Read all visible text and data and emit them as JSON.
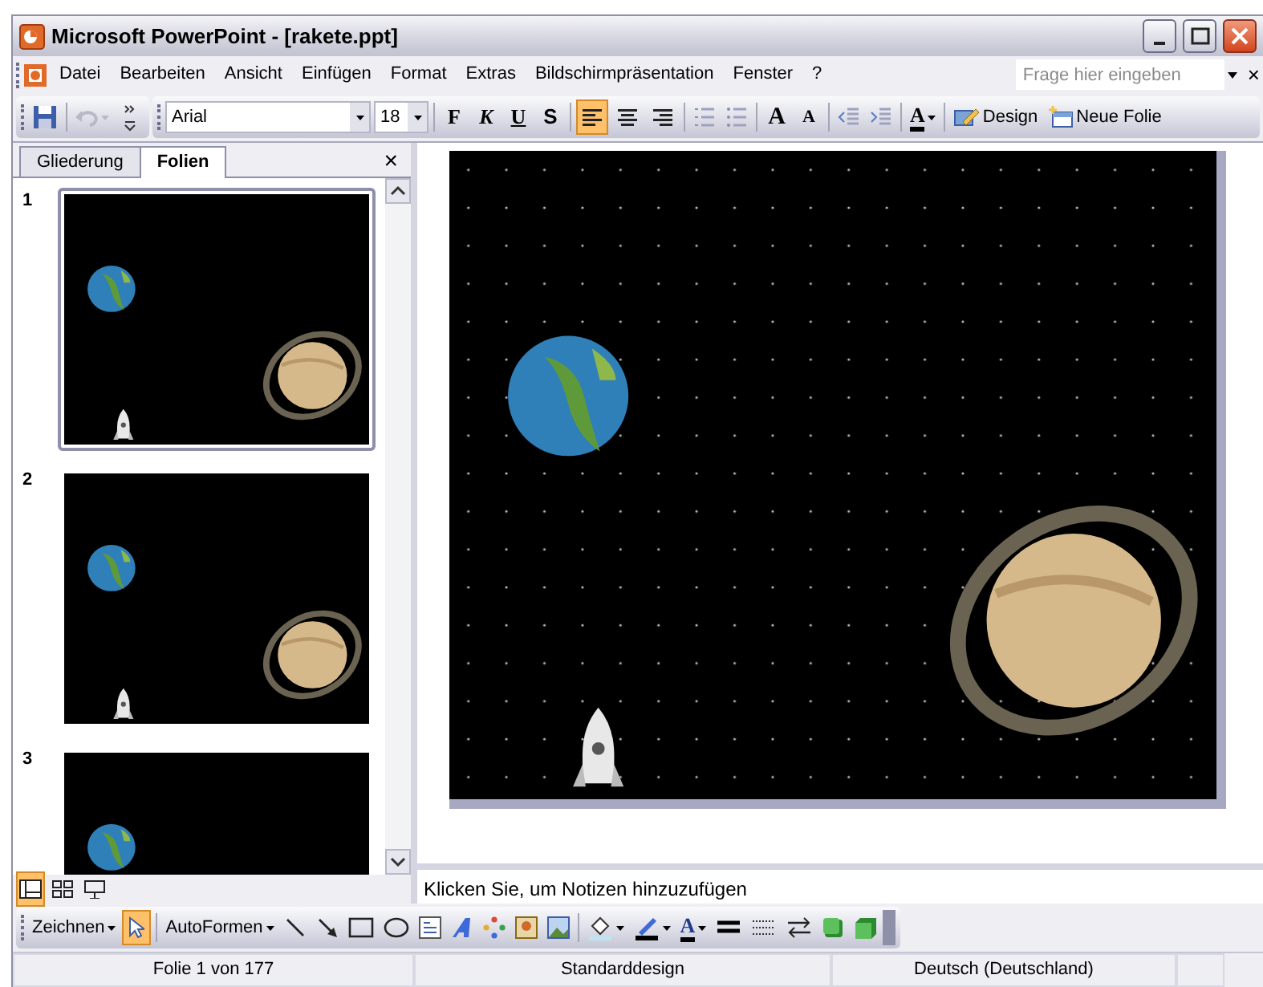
{
  "window": {
    "title": "Microsoft PowerPoint - [rakete.ppt]"
  },
  "menu": {
    "items": [
      {
        "label": "Datei"
      },
      {
        "label": "Bearbeiten"
      },
      {
        "label": "Ansicht"
      },
      {
        "label": "Einfügen"
      },
      {
        "label": "Format"
      },
      {
        "label": "Extras"
      },
      {
        "label": "Bildschirmpräsentation"
      },
      {
        "label": "Fenster"
      },
      {
        "label": "?"
      }
    ],
    "help_search": {
      "placeholder": "Frage hier eingeben"
    },
    "close": "×"
  },
  "formatting_toolbar": {
    "font": "Arial",
    "size": "18",
    "style_buttons": [
      "F",
      "K",
      "U",
      "S"
    ],
    "align": [
      {
        "selected": true
      },
      {
        "selected": false
      },
      {
        "selected": false
      }
    ],
    "grow_font": "A",
    "shrink_font": "A",
    "font_color": "A",
    "design": "Design",
    "new_slide": "Neue Folie"
  },
  "panel": {
    "tabs": [
      {
        "label": "Gliederung",
        "selected": false
      },
      {
        "label": "Folien",
        "selected": true
      }
    ],
    "close": "×",
    "slides": [
      {
        "number": "1",
        "selected": true
      },
      {
        "number": "2",
        "selected": false
      },
      {
        "number": "3",
        "selected": false
      }
    ]
  },
  "notes": {
    "text": "Klicken Sie, um Notizen hinzuzufügen"
  },
  "drawing_toolbar": {
    "draw": "Zeichnen",
    "pointer_selected": true,
    "autoshapes": "AutoFormen",
    "font_color": "A"
  },
  "status_bar": [
    "Folie 1 von 177",
    "Standarddesign",
    "Deutsch (Deutschland)"
  ]
}
